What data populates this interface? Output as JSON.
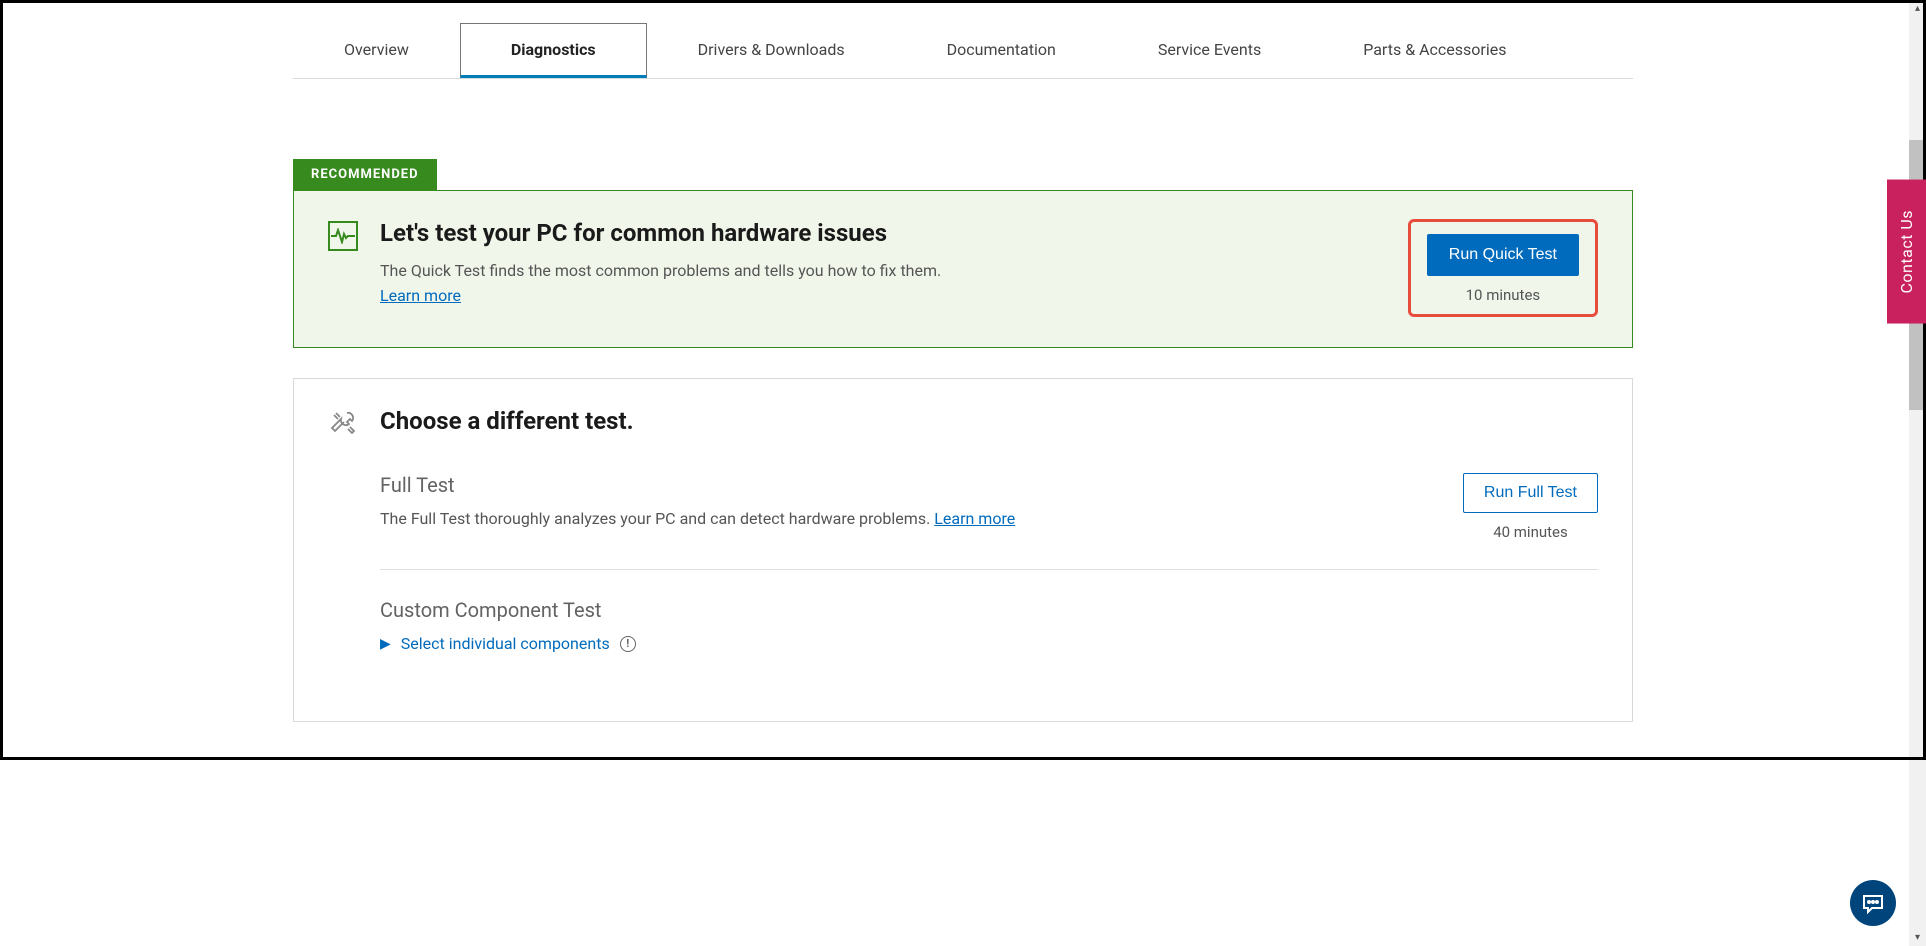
{
  "tabs": {
    "overview": "Overview",
    "diagnostics": "Diagnostics",
    "drivers": "Drivers & Downloads",
    "documentation": "Documentation",
    "service_events": "Service Events",
    "parts": "Parts & Accessories"
  },
  "recommended_badge": "RECOMMENDED",
  "quick_test": {
    "title": "Let's test your PC for common hardware issues",
    "description": "The Quick Test finds the most common problems and tells you how to fix them.",
    "learn_more": "Learn more",
    "button": "Run Quick Test",
    "duration": "10 minutes"
  },
  "other_tests": {
    "title": "Choose a different test.",
    "full_test": {
      "title": "Full Test",
      "description": "The Full Test thoroughly analyzes your PC and can detect hardware problems. ",
      "learn_more": "Learn more",
      "button": "Run Full Test",
      "duration": "40 minutes"
    },
    "custom_test": {
      "title": "Custom Component Test",
      "expand_text": "Select individual components"
    }
  },
  "contact_us": "Contact Us"
}
